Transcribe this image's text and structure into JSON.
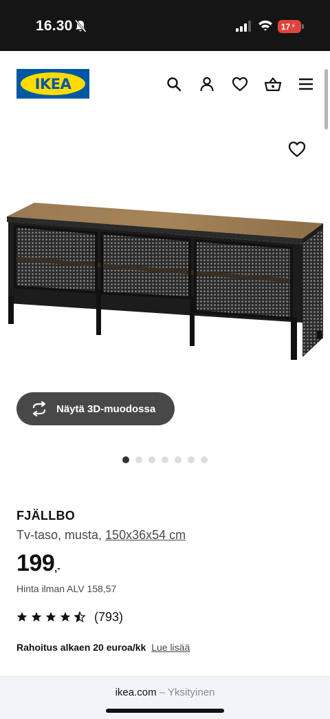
{
  "status_bar": {
    "time": "16.30",
    "battery_level": "17"
  },
  "header": {
    "logo_text": "IKEA",
    "icons": [
      "search-icon",
      "user-icon",
      "heart-icon",
      "basket-icon",
      "menu-icon"
    ]
  },
  "gallery": {
    "view_3d_label": "Näytä 3D-muodossa",
    "slide_count": 7,
    "active_slide": 1
  },
  "product": {
    "name": "FJÄLLBO",
    "type": "Tv-taso, musta,",
    "dimensions": "150x36x54 cm",
    "price_integer": "199",
    "price_suffix": ",-",
    "price_vat_text": "Hinta ilman ALV 158,57",
    "rating": 4.5,
    "review_count": "(793)"
  },
  "finance": {
    "text": "Rahoitus alkaen 20 euroa/kk",
    "link": "Lue lisää"
  },
  "browser_bar": {
    "host": "ikea.com",
    "separator": "–",
    "label": "Yksityinen"
  },
  "colors": {
    "ikea_blue": "#0058a3",
    "ikea_yellow": "#ffdb00",
    "button_dark": "#484848",
    "battery_red": "#e0443e"
  }
}
